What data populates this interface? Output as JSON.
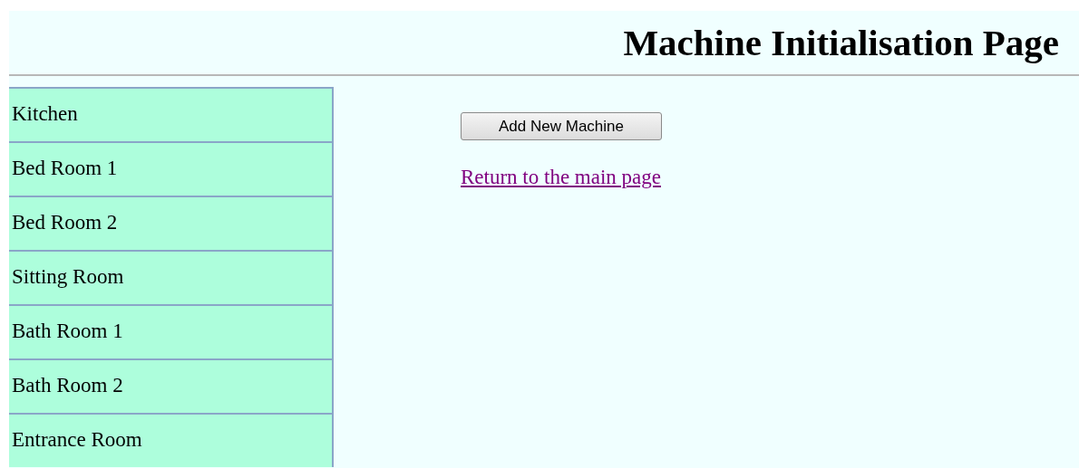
{
  "page": {
    "title": "Machine Initialisation Page"
  },
  "sidebar": {
    "items": [
      {
        "label": "Kitchen"
      },
      {
        "label": "Bed Room 1"
      },
      {
        "label": "Bed Room 2"
      },
      {
        "label": "Sitting Room"
      },
      {
        "label": "Bath Room 1"
      },
      {
        "label": "Bath Room 2"
      },
      {
        "label": "Entrance Room"
      }
    ]
  },
  "content": {
    "button": "Add New Machine",
    "link": "Return to the main page"
  }
}
